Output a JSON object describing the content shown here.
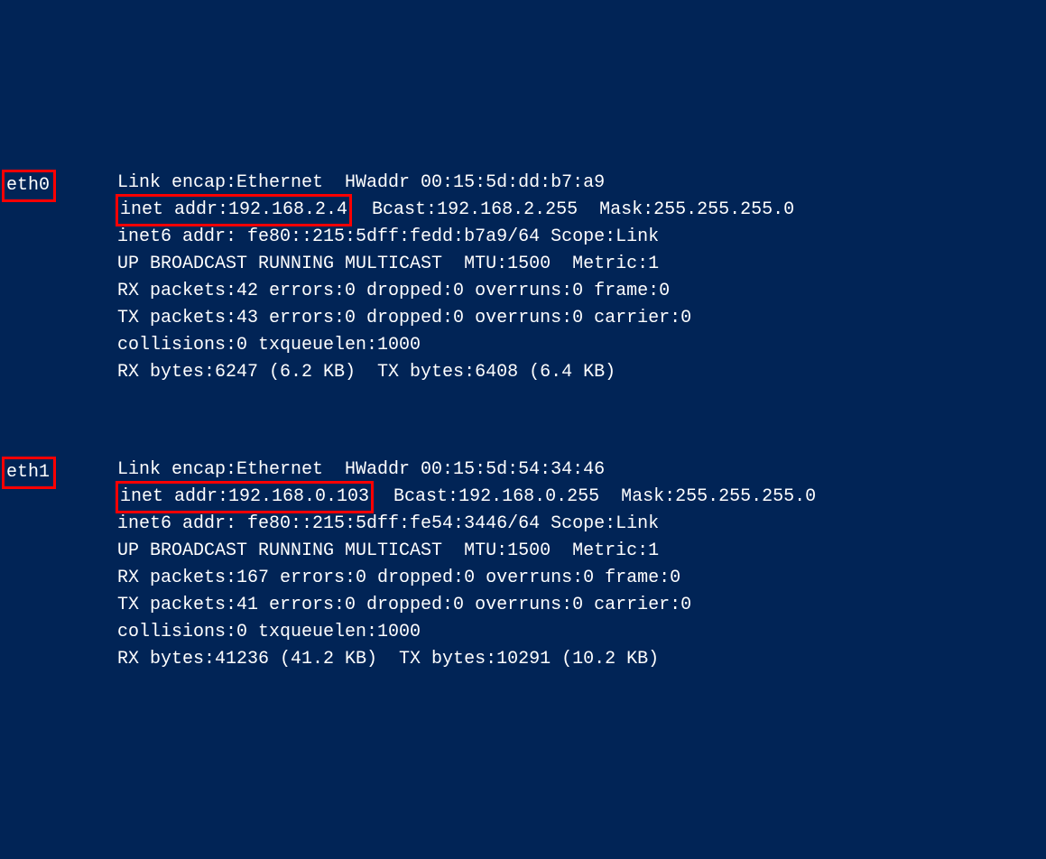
{
  "interfaces": [
    {
      "name": "eth0",
      "link_encap": "Link encap:Ethernet  HWaddr 00:15:5d:dd:b7:a9",
      "inet_addr": "inet addr:192.168.2.4",
      "inet_rest": "  Bcast:192.168.2.255  Mask:255.255.255.0",
      "inet6": "inet6 addr: fe80::215:5dff:fedd:b7a9/64 Scope:Link",
      "flags": "UP BROADCAST RUNNING MULTICAST  MTU:1500  Metric:1",
      "rx_packets": "RX packets:42 errors:0 dropped:0 overruns:0 frame:0",
      "tx_packets": "TX packets:43 errors:0 dropped:0 overruns:0 carrier:0",
      "collisions": "collisions:0 txqueuelen:1000",
      "bytes": "RX bytes:6247 (6.2 KB)  TX bytes:6408 (6.4 KB)"
    },
    {
      "name": "eth1",
      "link_encap": "Link encap:Ethernet  HWaddr 00:15:5d:54:34:46",
      "inet_addr": "inet addr:192.168.0.103",
      "inet_rest": "  Bcast:192.168.0.255  Mask:255.255.255.0",
      "inet6": "inet6 addr: fe80::215:5dff:fe54:3446/64 Scope:Link",
      "flags": "UP BROADCAST RUNNING MULTICAST  MTU:1500  Metric:1",
      "rx_packets": "RX packets:167 errors:0 dropped:0 overruns:0 frame:0",
      "tx_packets": "TX packets:41 errors:0 dropped:0 overruns:0 carrier:0",
      "collisions": "collisions:0 txqueuelen:1000",
      "bytes": "RX bytes:41236 (41.2 KB)  TX bytes:10291 (10.2 KB)"
    }
  ]
}
